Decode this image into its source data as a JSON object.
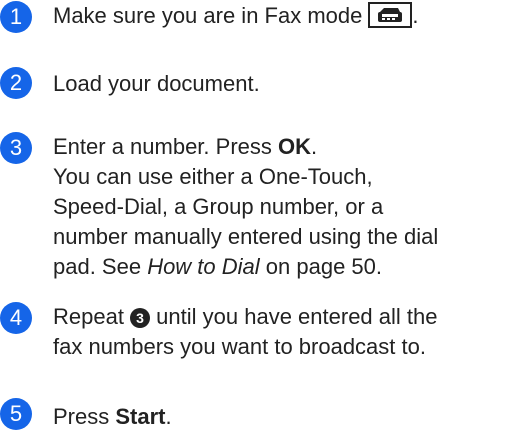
{
  "accent_color": "#1565e8",
  "steps": [
    {
      "number": "1",
      "text": "Make sure you are in Fax mode",
      "key_icon": "fax-key-icon",
      "period": "."
    },
    {
      "number": "2",
      "text": "Load your document."
    },
    {
      "number": "3",
      "line1_pre": "Enter a number. Press ",
      "line1_bold": "OK",
      "line1_post": ".",
      "line2": "You can use either a One-Touch,",
      "line3": "Speed-Dial, a Group number, or a",
      "line4": "number manually entered using the dial",
      "line5_pre": "pad. See ",
      "line5_italic": "How to Dial",
      "line5_post": " on page 50."
    },
    {
      "number": "4",
      "line1_pre": "Repeat ",
      "step_ref": "3",
      "line1_post": " until you have entered all the",
      "line2": "fax numbers you want to broadcast to."
    },
    {
      "number": "5",
      "pre": "Press ",
      "bold": "Start",
      "post": "."
    }
  ]
}
